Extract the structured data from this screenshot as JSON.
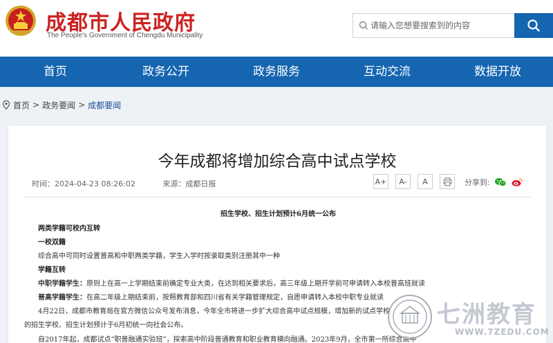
{
  "header": {
    "site_title": "成都市人民政府",
    "site_subtitle": "The People's Government of Chengdu Municipality",
    "emblem_icon": "national-emblem-icon",
    "search_placeholder": "请输入您想要搜索到的内容",
    "search_icon": "search-icon"
  },
  "nav": {
    "items": [
      {
        "label": "首页"
      },
      {
        "label": "政务公开"
      },
      {
        "label": "政务服务"
      },
      {
        "label": "互动交流"
      },
      {
        "label": "数据开放"
      }
    ]
  },
  "breadcrumb": {
    "icon": "location-pin-icon",
    "items": [
      "首页",
      "政务要闻",
      "成都要闻"
    ],
    "separator": ">"
  },
  "article": {
    "title": "今年成都将增加综合高中试点学校",
    "time": "时间：2024-04-23 08:26:02",
    "source": "来源：成都日报",
    "font_buttons": [
      "A+",
      "A-",
      "A"
    ],
    "print_icon": "print-icon",
    "share_label": "分享到:",
    "share_icons": [
      "wechat-icon",
      "weibo-icon"
    ],
    "paragraphs": [
      {
        "text": "招生学校、招生计划预计6月统一公布",
        "bold": true
      },
      {
        "text": "两类学籍可校内互转",
        "bold": true
      },
      {
        "text": "一校双籍",
        "bold": true
      },
      {
        "text": "综合高中可同时设置普高和中职两类学籍，学生入学时按录取类别注册其中一种",
        "bold": false
      },
      {
        "text": "学籍互转",
        "bold": true
      },
      {
        "text": "中职学籍学生：",
        "bold": true
      },
      {
        "text": "原则上在高一上学期结束前确定专业大类，在达到相关要求后，高三年级上期开学前可申请转入本校普高班就读",
        "bold": false
      },
      {
        "text": "普高学籍学生：",
        "bold": true
      },
      {
        "text": "在高二年级上期结束前，按照教育部和四川省有关学籍管理规定，自愿申请转入本校中职专业就读",
        "bold": false
      },
      {
        "text": "4月22日，成都市教育局在官方微信公众号发布消息，今年全市将进一步扩大综合高中试点规模，增加新的试点学校",
        "bold": false
      },
      {
        "text": "的招生学校、招生计划预计于6月初统一向社会公布。",
        "bold": false
      },
      {
        "text": "自2017年起，成都试点“职普融通实验班”，探索高中阶段普通教育和职业教育横向融通。2023年9月，全市第一所综合高中",
        "bold": false
      }
    ]
  },
  "watermark": {
    "brand": "七洲教育",
    "url": "WWW.7ZEDU.COM"
  },
  "colors": {
    "brand_red": "#cc2222",
    "nav_blue": "#1565b0",
    "link_blue": "#1a4f99"
  }
}
